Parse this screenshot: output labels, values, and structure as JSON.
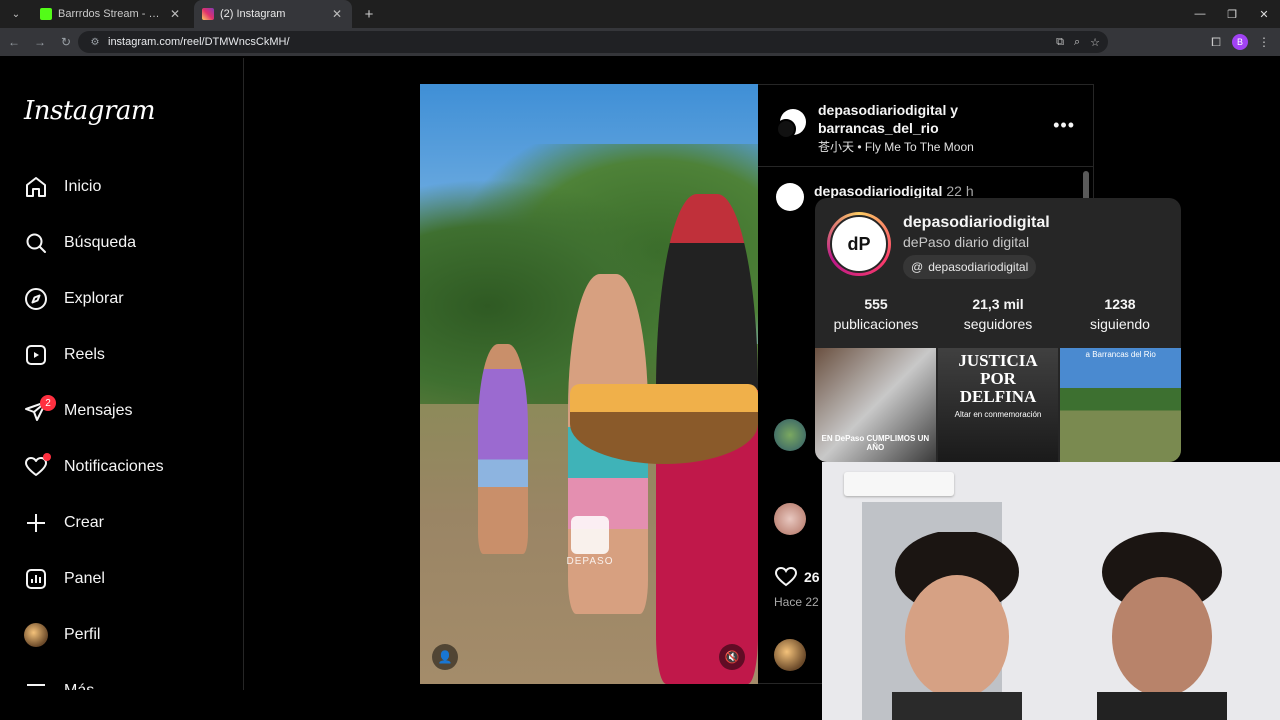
{
  "browser": {
    "tabs": [
      {
        "title": "Barrrdos Stream - Watch Live o",
        "favicon_color": "#53fc18",
        "active": false
      },
      {
        "title": "(2) Instagram",
        "favicon_color": "#e1306c",
        "active": true
      }
    ],
    "url": "instagram.com/reel/DTMWncsCkMH/"
  },
  "sidebar": {
    "logo": "Instagram",
    "items": [
      {
        "label": "Inicio",
        "icon": "home-icon"
      },
      {
        "label": "Búsqueda",
        "icon": "search-icon"
      },
      {
        "label": "Explorar",
        "icon": "compass-icon"
      },
      {
        "label": "Reels",
        "icon": "reels-icon"
      },
      {
        "label": "Mensajes",
        "icon": "messenger-icon",
        "badge": "2"
      },
      {
        "label": "Notificaciones",
        "icon": "heart-icon"
      },
      {
        "label": "Crear",
        "icon": "plus-icon"
      },
      {
        "label": "Panel",
        "icon": "chart-icon"
      },
      {
        "label": "Perfil",
        "icon": "avatar"
      },
      {
        "label": "Más",
        "icon": "menu-icon"
      }
    ]
  },
  "reel": {
    "brand": "DEPASO"
  },
  "post": {
    "names_line1": "depasodiariodigital y",
    "names_line2": "barrancas_del_rio",
    "audio": "苍小天 • Fly Me To The Moon",
    "comment_user": "depasodiariodigital",
    "comment_time": "22 h",
    "likes": "26",
    "ago": "Hace 22"
  },
  "hovercard": {
    "username": "depasodiariodigital",
    "full_name": "dePaso diario digital",
    "threads": "depasodiariodigital",
    "stats": [
      {
        "n": "555",
        "l": "publicaciones"
      },
      {
        "n": "21,3 mil",
        "l": "seguidores"
      },
      {
        "n": "1238",
        "l": "siguiendo"
      }
    ],
    "thumbs": [
      {
        "caption": "EN DePaso CUMPLIMOS UN AÑO"
      },
      {
        "caption": "JUSTICIA POR DELFINA",
        "sub": "Altar en conmemoración"
      },
      {
        "caption": "a Barrancas del Rio"
      }
    ]
  },
  "colors": {
    "notification": "#ff3040",
    "panel": "#262626"
  }
}
